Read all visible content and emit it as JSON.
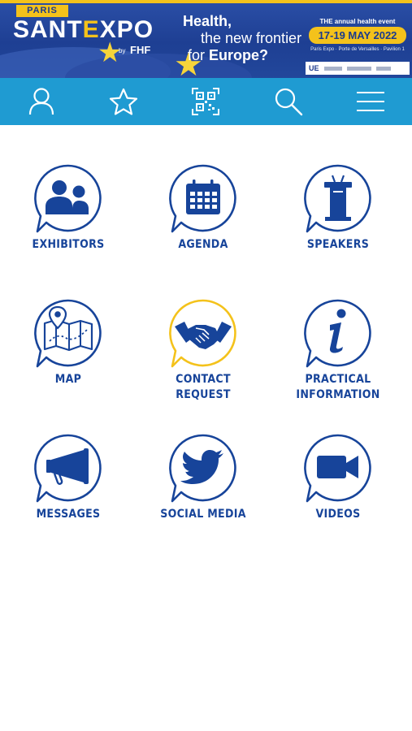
{
  "banner": {
    "tag": "PARIS",
    "logo_main": "SANT",
    "logo_accent": "E",
    "logo_rest": "XPO",
    "logo_by": "by",
    "logo_partner": "FHF",
    "headline_line1": "Health,",
    "headline_line2": "the new frontier",
    "headline_line3_pre": "for ",
    "headline_line3_bold": "Europe?",
    "event_kicker": "THE annual health event",
    "event_dates": "17-19 MAY 2022",
    "event_venue": "Paris Expo · Porte de Versailles · Pavilion 1",
    "sponsor_logo": "UE"
  },
  "nav": {
    "items": [
      {
        "name": "profile",
        "icon": "user-icon"
      },
      {
        "name": "favorites",
        "icon": "star-icon"
      },
      {
        "name": "qr-scan",
        "icon": "qr-code-icon"
      },
      {
        "name": "search",
        "icon": "search-icon"
      },
      {
        "name": "menu",
        "icon": "hamburger-menu-icon"
      }
    ]
  },
  "tiles": [
    {
      "label": "EXHIBITORS",
      "icon": "exhibitors-icon"
    },
    {
      "label": "AGENDA",
      "icon": "calendar-icon"
    },
    {
      "label": "SPEAKERS",
      "icon": "podium-icon"
    },
    {
      "label": "MAP",
      "icon": "map-icon"
    },
    {
      "label_line1": "CONTACT",
      "label_line2": "REQUEST",
      "icon": "handshake-icon"
    },
    {
      "label_line1": "PRACTICAL",
      "label_line2": "INFORMATION",
      "icon": "info-icon"
    },
    {
      "label": "MESSAGES",
      "icon": "megaphone-icon"
    },
    {
      "label": "SOCIAL MEDIA",
      "icon": "twitter-bird-icon"
    },
    {
      "label": "VIDEOS",
      "icon": "video-camera-icon"
    }
  ],
  "colors": {
    "brand_blue": "#17449a",
    "nav_blue": "#1f9bd2",
    "accent_yellow": "#f4c21b",
    "banner_blue": "#1e3f93"
  }
}
